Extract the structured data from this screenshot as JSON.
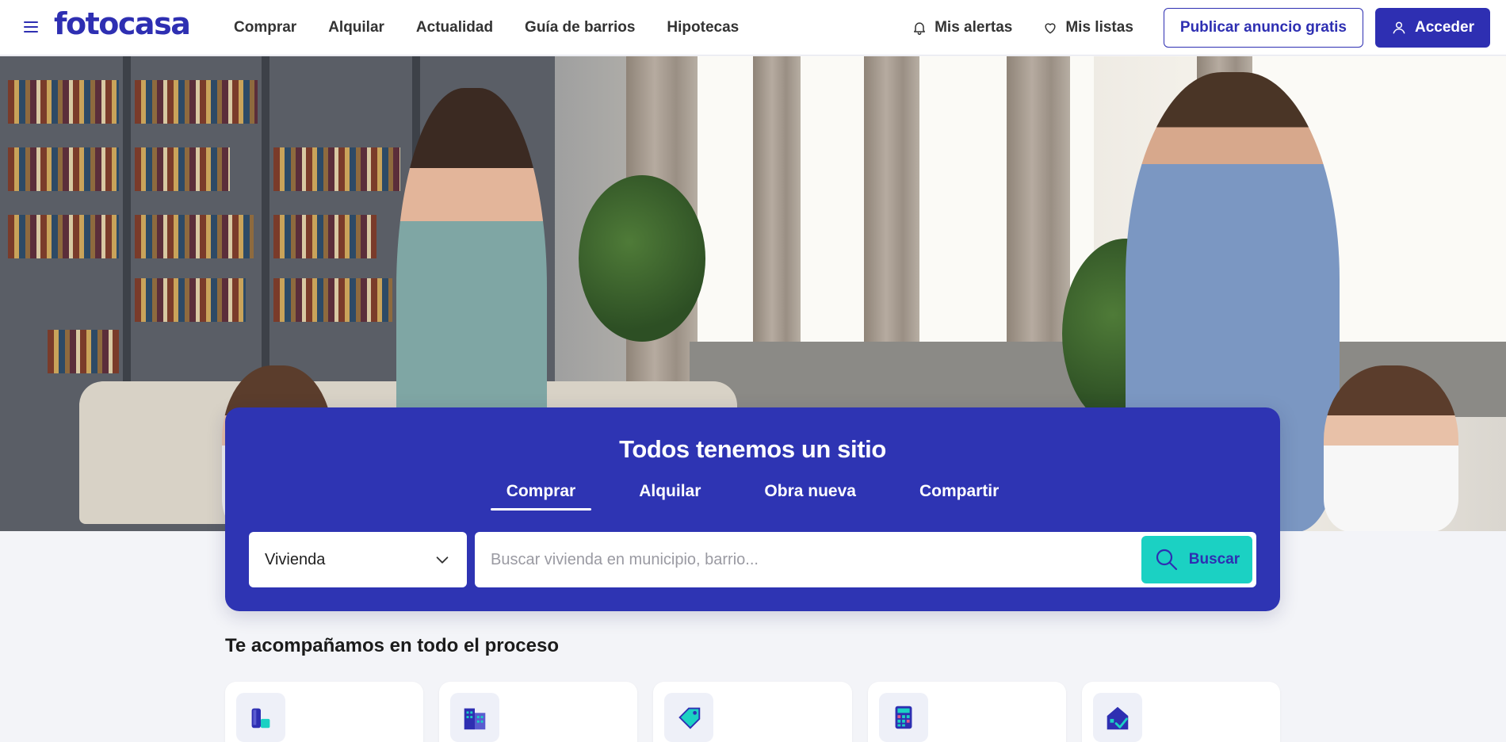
{
  "header": {
    "logo": "fotocasa",
    "nav": [
      "Comprar",
      "Alquilar",
      "Actualidad",
      "Guía de barrios",
      "Hipotecas"
    ],
    "alerts_label": "Mis alertas",
    "lists_label": "Mis listas",
    "publish_label": "Publicar anuncio gratis",
    "login_label": "Acceder"
  },
  "search": {
    "title": "Todos tenemos un sitio",
    "tabs": [
      "Comprar",
      "Alquilar",
      "Obra nueva",
      "Compartir"
    ],
    "active_tab": "Comprar",
    "property_type": "Vivienda",
    "placeholder": "Buscar vivienda en municipio, barrio...",
    "button_label": "Buscar"
  },
  "process": {
    "title": "Te acompañamos en todo el proceso",
    "cards": [
      {
        "icon": "savings-jar-icon"
      },
      {
        "icon": "buildings-icon"
      },
      {
        "icon": "price-tag-icon"
      },
      {
        "icon": "calculator-icon"
      },
      {
        "icon": "house-check-icon"
      }
    ]
  },
  "colors": {
    "brand": "#2e2fb2",
    "panel": "#2e34b3",
    "search_button": "#1bd1c3",
    "background": "#f3f4f8"
  }
}
